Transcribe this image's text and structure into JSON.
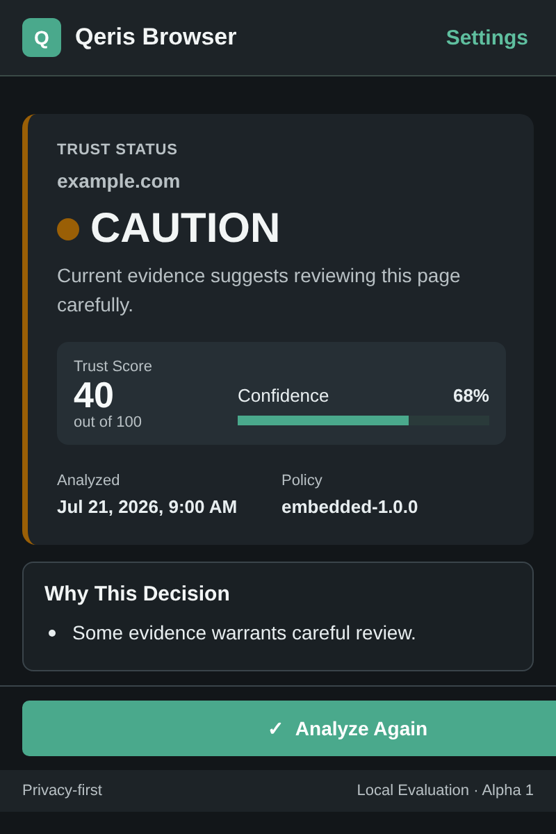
{
  "header": {
    "logo": "Q",
    "title": "Qeris Browser",
    "settings": "Settings"
  },
  "trust": {
    "label": "TRUST STATUS",
    "domain": "example.com",
    "status": "CAUTION",
    "color": "#9a5f06",
    "description": "Current evidence suggests reviewing this page carefully.",
    "score_label": "Trust Score",
    "score": "40",
    "score_suffix": "out of 100",
    "confidence_label": "Confidence",
    "confidence_reading": "68%",
    "level": 0.68,
    "meta": [
      {
        "label": "Analyzed",
        "value": "Jul 21, 2026, 9:00 AM"
      },
      {
        "label": "Policy",
        "value": "embedded-1.0.0"
      }
    ]
  },
  "why": {
    "title": "Why This Decision",
    "reasons": [
      "Some evidence warrants careful review."
    ]
  },
  "action": {
    "label": "Analyze Again",
    "icon": "✓"
  },
  "footer": {
    "left": "Privacy-first",
    "right": "Local Evaluation · Alpha 1"
  }
}
